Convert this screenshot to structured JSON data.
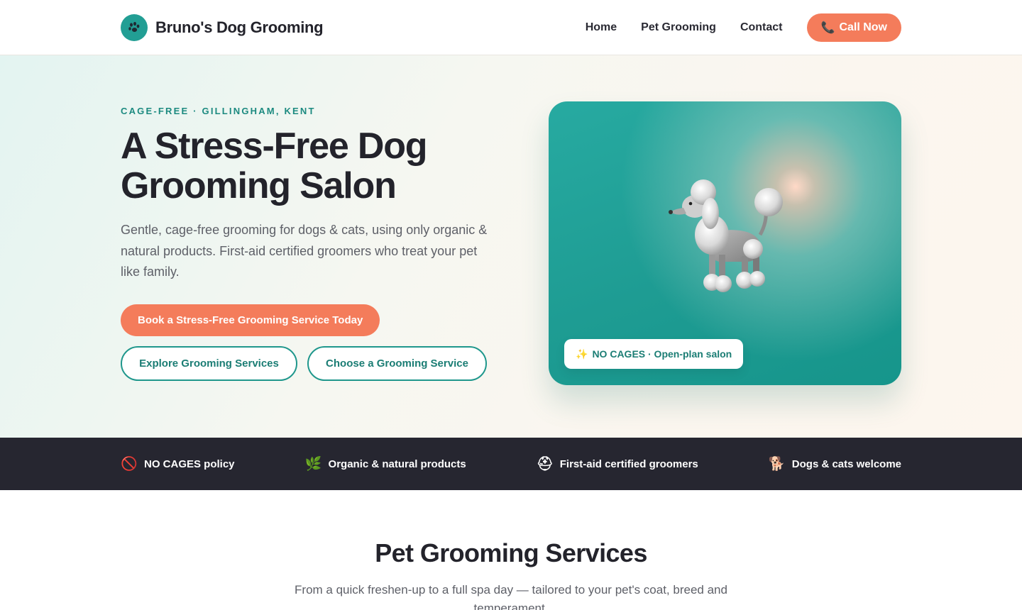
{
  "header": {
    "brand_name": "Bruno's Dog Grooming",
    "logo_icon": "paw-prints",
    "nav": [
      {
        "label": "Home"
      },
      {
        "label": "Pet Grooming"
      },
      {
        "label": "Contact"
      }
    ],
    "call_label": "Call Now",
    "call_icon": "📞"
  },
  "hero": {
    "eyebrow": "CAGE-FREE · GILLINGHAM, KENT",
    "title": "A Stress-Free Dog Grooming Salon",
    "subtitle": "Gentle, cage-free grooming for dogs & cats, using only organic & natural products. First-aid certified groomers who treat your pet like family.",
    "primary_cta": "Book a Stress-Free Grooming Service Today",
    "secondary_cta": "Explore Grooming Services",
    "tertiary_cta": "Choose a Grooming Service",
    "card_badge_icon": "✨",
    "card_badge_text": "NO CAGES · Open-plan salon"
  },
  "features": [
    {
      "icon": "🚫",
      "label": "NO CAGES policy"
    },
    {
      "icon": "🌿",
      "label": "Organic & natural products"
    },
    {
      "icon": "⛑",
      "label": "First-aid certified groomers"
    },
    {
      "icon": "🐕",
      "label": "Dogs & cats welcome"
    }
  ],
  "services": {
    "title": "Pet Grooming Services",
    "subtitle": "From a quick freshen-up to a full spa day — tailored to your pet's coat, breed and temperament."
  },
  "colors": {
    "accent": "#f47c5b",
    "teal": "#229e94",
    "dark_band": "#262630"
  }
}
